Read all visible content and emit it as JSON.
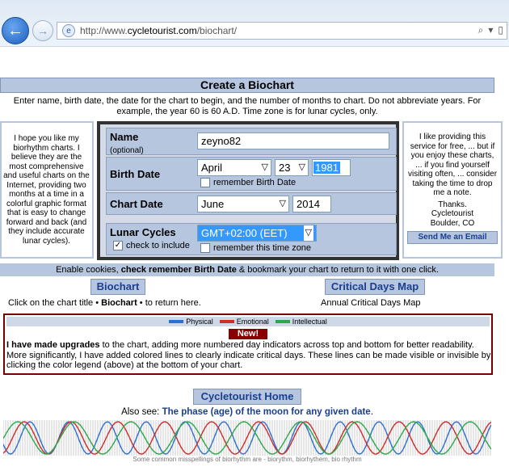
{
  "browser": {
    "url_prefix": "http://www.",
    "url_domain": "cycletourist.com",
    "url_path": "/biochart/"
  },
  "page": {
    "title": "Create a Biochart",
    "intro": "Enter name, birth date, the date for the chart to begin, and the number of months to chart. Do not abbreviate years.  For example, the year 60 is 60 A.D.  Time zone is for lunar cycles, only."
  },
  "left_note": "I hope you like my biorhythm charts. I believe they are the most comprehensive and useful charts on the Internet, providing two months at a time in a colorful graphic format that is easy to change forward and back (and they include accurate lunar cycles).",
  "right_note": {
    "text": "I like providing this service for free, ... but if you enjoy these charts, ... if you find yourself visiting often, ... consider taking the time to drop me a note.",
    "thanks": "Thanks.",
    "sig1": "Cycletourist",
    "sig2": "Boulder, CO",
    "email_label": "Send Me an Email"
  },
  "form": {
    "name_label": "Name",
    "name_optional": "(optional)",
    "name_value": "zeyno82",
    "birth_label": "Birth Date",
    "birth_month": "April",
    "birth_day": "23",
    "birth_year": "1981",
    "remember_birth": "remember Birth Date",
    "chart_label": "Chart Date",
    "chart_month": "June",
    "chart_year": "2014",
    "lunar_label": "Lunar Cycles",
    "lunar_check": "check to include",
    "timezone": "GMT+02:00 (EET)",
    "remember_tz": "remember this time zone"
  },
  "cookie": {
    "pre": "Enable cookies, ",
    "bold": "check remember Birth Date",
    "post": " & bookmark your chart to return to it with one click."
  },
  "buttons": {
    "biochart": "Biochart",
    "critical": "Critical Days Map",
    "home": "Cycletourist Home"
  },
  "captions": {
    "biochart_pre": "Click on the chart title • ",
    "biochart_bold": "Biochart",
    "biochart_post": " • to return here.",
    "critical": "Annual Critical Days Map"
  },
  "legend": [
    {
      "label": "Physical",
      "color": "#2a6fd1"
    },
    {
      "label": "Emotional",
      "color": "#d12a2a"
    },
    {
      "label": "Intellectual",
      "color": "#2aa84a"
    }
  ],
  "upgrade": {
    "new": "New!",
    "bold": "I have made upgrades",
    "text": " to the chart, adding more numbered day indicators across top and bottom for better readability.  More significantly, I have added colored lines to clearly indicate critical days. These lines can be made visible or invisible by clicking the color legend (above) at the bottom of your chart."
  },
  "alsosee": {
    "pre": "Also see: ",
    "link": "The phase (age) of the moon for any given date",
    "post": "."
  },
  "misspell": "Some common misspellings of biorhythm are - biorythm, biorhythem, bio rhythm"
}
